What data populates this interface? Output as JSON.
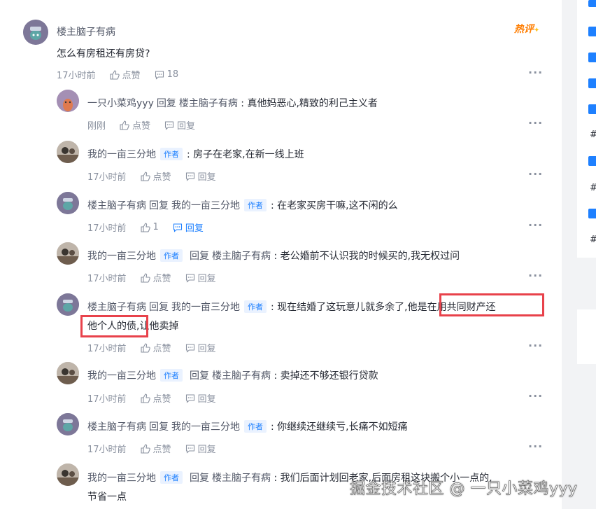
{
  "root": {
    "username": "楼主脑子有病",
    "badge": "热评",
    "content": "怎么有房租还有房贷?",
    "time": "17小时前",
    "like_label": "点赞",
    "comment_count": "18"
  },
  "labels": {
    "like": "点赞",
    "reply": "回复",
    "reply_word": "回复",
    "author_tag": "作者"
  },
  "replies": [
    {
      "user": "一只小菜鸡yyy",
      "target": "楼主脑子有病",
      "target_author": false,
      "author": false,
      "content": "真他妈恶心,精致的利己主义者",
      "time": "刚刚",
      "likes": "点赞"
    },
    {
      "user": "我的一亩三分地",
      "target": "",
      "target_author": false,
      "author": true,
      "content": "房子在老家,在新一线上班",
      "time": "17小时前",
      "likes": "点赞"
    },
    {
      "user": "楼主脑子有病",
      "target": "我的一亩三分地",
      "target_author": true,
      "author": false,
      "content": "在老家买房干嘛,这不闲的么",
      "time": "17小时前",
      "likes": "1"
    },
    {
      "user": "我的一亩三分地",
      "target": "楼主脑子有病",
      "target_author": false,
      "author": true,
      "content": "老公婚前不认识我的时候买的,我无权过问",
      "time": "17小时前",
      "likes": "点赞"
    },
    {
      "user": "楼主脑子有病",
      "target": "我的一亩三分地",
      "target_author": true,
      "author": false,
      "content_line1": "现在结婚了这玩意儿就多余了,他是在用共同财产还",
      "content_line2": "他个人的债,让他卖掉",
      "time": "17小时前",
      "likes": "点赞"
    },
    {
      "user": "我的一亩三分地",
      "target": "楼主脑子有病",
      "target_author": false,
      "author": true,
      "content": "卖掉还不够还银行贷款",
      "time": "17小时前",
      "likes": "点赞"
    },
    {
      "user": "楼主脑子有病",
      "target": "我的一亩三分地",
      "target_author": true,
      "author": false,
      "content": "你继续还继续亏,长痛不如短痛",
      "time": "17小时前",
      "likes": "点赞"
    },
    {
      "user": "我的一亩三分地",
      "target": "楼主脑子有病",
      "target_author": false,
      "author": true,
      "content_line1": "我们后面计划回老家,后面房租这块搬个小一点的,",
      "content_line2": "节省一点",
      "time": "",
      "likes": ""
    }
  ],
  "watermark": "掘金技术社区 @ 一只小菜鸡yyy",
  "sidebar_hash": "#",
  "colors": {
    "accent": "#1e80ff",
    "highlight": "#e8424b",
    "hot": "#ff7d00"
  }
}
